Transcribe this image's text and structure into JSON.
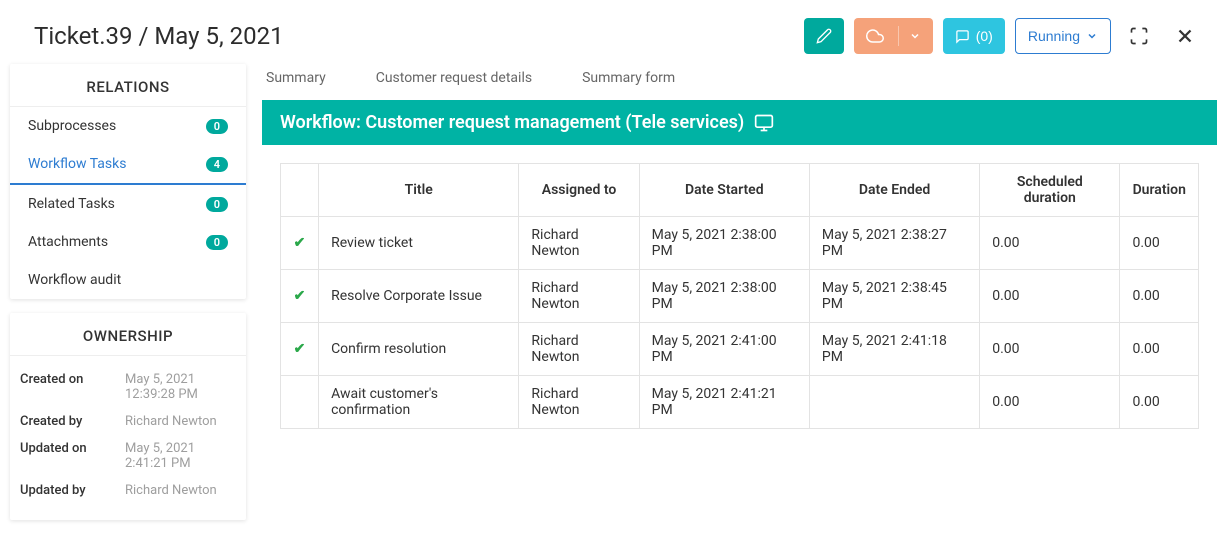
{
  "header": {
    "title": "Ticket.39 / May 5, 2021",
    "comments_label": "(0)",
    "running_label": "Running"
  },
  "tabs": [
    {
      "label": "Summary"
    },
    {
      "label": "Customer request details"
    },
    {
      "label": "Summary form"
    }
  ],
  "relations": {
    "header": "RELATIONS",
    "items": [
      {
        "label": "Subprocesses",
        "count": "0"
      },
      {
        "label": "Workflow Tasks",
        "count": "4"
      },
      {
        "label": "Related Tasks",
        "count": "0"
      },
      {
        "label": "Attachments",
        "count": "0"
      },
      {
        "label": "Workflow audit",
        "count": null
      }
    ]
  },
  "ownership": {
    "header": "OWNERSHIP",
    "rows": [
      {
        "label": "Created on",
        "value": "May 5, 2021 12:39:28 PM"
      },
      {
        "label": "Created by",
        "value": "Richard Newton"
      },
      {
        "label": "Updated on",
        "value": "May 5, 2021 2:41:21 PM"
      },
      {
        "label": "Updated by",
        "value": "Richard Newton"
      }
    ]
  },
  "workflow": {
    "banner": "Workflow: Customer request management (Tele services)"
  },
  "table": {
    "headers": {
      "title": "Title",
      "assigned": "Assigned to",
      "started": "Date Started",
      "ended": "Date Ended",
      "scheduled": "Scheduled duration",
      "duration": "Duration"
    },
    "rows": [
      {
        "done": true,
        "title": "Review ticket",
        "assigned": "Richard Newton",
        "started": "May 5, 2021 2:38:00 PM",
        "ended": "May 5, 2021 2:38:27 PM",
        "scheduled": "0.00",
        "duration": "0.00"
      },
      {
        "done": true,
        "title": "Resolve Corporate Issue",
        "assigned": "Richard Newton",
        "started": "May 5, 2021 2:38:00 PM",
        "ended": "May 5, 2021 2:38:45 PM",
        "scheduled": "0.00",
        "duration": "0.00"
      },
      {
        "done": true,
        "title": "Confirm resolution",
        "assigned": "Richard Newton",
        "started": "May 5, 2021 2:41:00 PM",
        "ended": "May 5, 2021 2:41:18 PM",
        "scheduled": "0.00",
        "duration": "0.00"
      },
      {
        "done": false,
        "title": "Await customer's confirmation",
        "assigned": "Richard Newton",
        "started": "May 5, 2021 2:41:21 PM",
        "ended": "",
        "scheduled": "0.00",
        "duration": "0.00"
      }
    ]
  }
}
